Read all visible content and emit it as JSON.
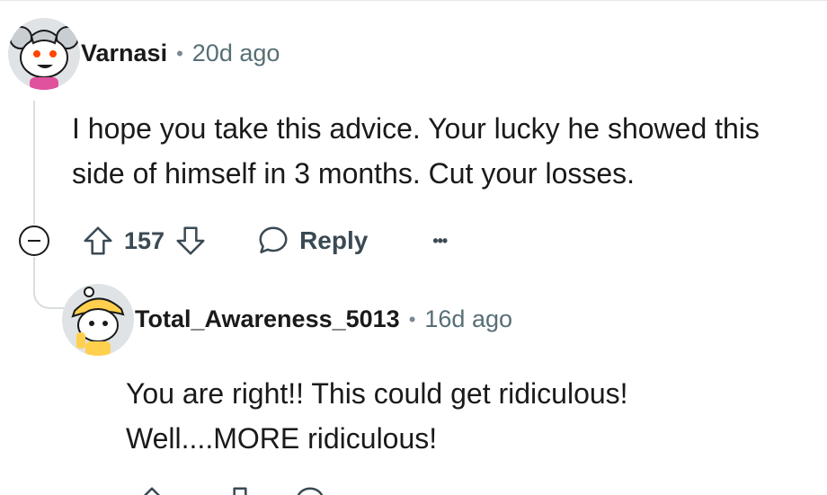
{
  "comments": [
    {
      "author": "Varnasi",
      "separator": "•",
      "time": "20d ago",
      "lines": [
        "I hope you take this advice. Your lucky he showed this",
        "side of himself in 3 months. Cut your losses."
      ],
      "score": "157",
      "reply_label": "Reply",
      "more_label": "•••"
    },
    {
      "author": "Total_Awareness_5013",
      "separator": "•",
      "time": "16d ago",
      "lines": [
        "You are right!! This could get ridiculous!",
        "Well....MORE ridiculous!"
      ]
    }
  ],
  "colors": {
    "text": "#1a1a1b",
    "meta": "#576f76",
    "thread_line": "#d9dde0",
    "action": "#3a4a54"
  },
  "icons": {
    "collapse": "minus-circle-icon",
    "upvote": "arrow-up-icon",
    "downvote": "arrow-down-icon",
    "reply": "speech-bubble-icon",
    "more": "ellipsis-icon"
  }
}
